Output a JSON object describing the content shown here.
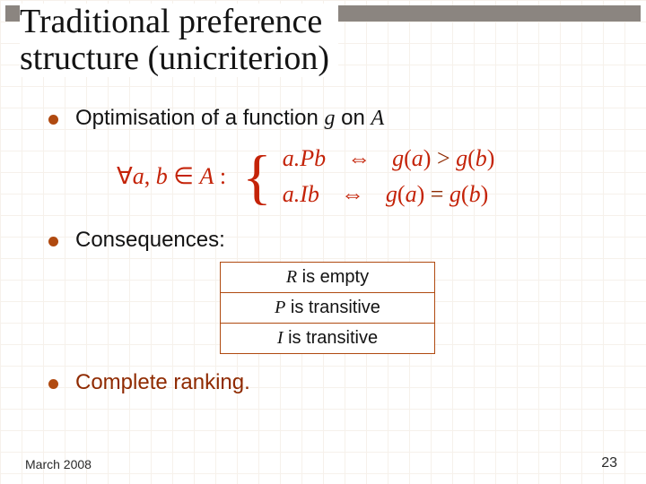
{
  "title_line1": "Traditional preference",
  "title_line2": "structure (unicriterion)",
  "bullets": {
    "b1_pre": "Optimisation of a function ",
    "b1_g": "g",
    "b1_mid": " on ",
    "b1_A": "A",
    "b2": "Consequences:",
    "b3": "Complete ranking."
  },
  "math": {
    "forall": "∀",
    "a": "a",
    "comma": ", ",
    "b": "b",
    "in": " ∈ ",
    "A": "A",
    "colon": " :",
    "brace": "{",
    "case1_rel_a": "a",
    "case1_rel_op": ".P",
    "case1_rel_b": "b",
    "iff": "⇔",
    "case1_rhs_g1": "g",
    "case1_rhs_lp": "(",
    "case1_rhs_a": "a",
    "case1_rhs_rp": ")",
    "case1_rhs_gt": " > ",
    "case1_rhs_g2": "g",
    "case1_rhs_b": "b",
    "case2_rel_a": "a",
    "case2_rel_op": ".I",
    "case2_rel_b": "b",
    "case2_rhs_eq": " = "
  },
  "table": {
    "r1_sym": "R",
    "r1_txt": " is empty",
    "r2_sym": "P",
    "r2_txt": " is transitive",
    "r3_sym": "I",
    "r3_txt": " is transitive"
  },
  "footer": {
    "date": "March 2008",
    "page": "23"
  }
}
